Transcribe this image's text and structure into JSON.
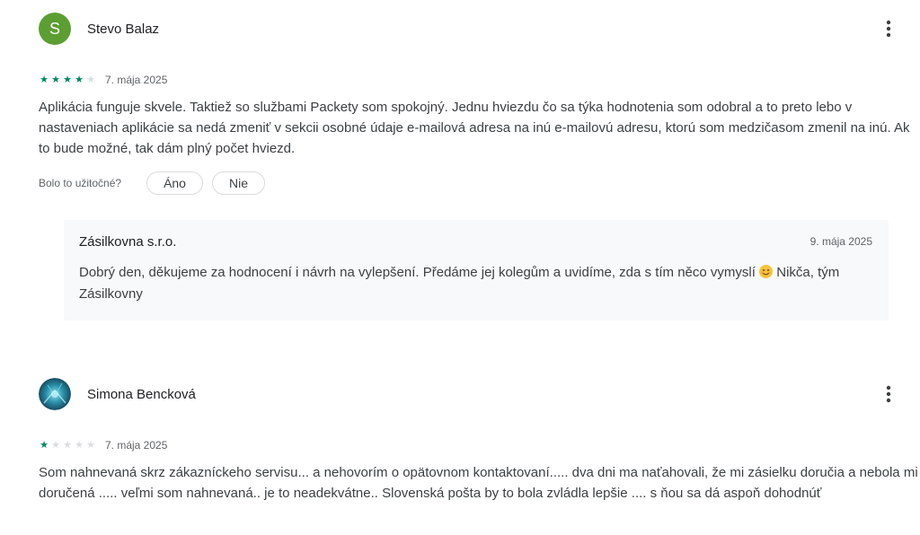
{
  "reviews": [
    {
      "author": "Stevo Balaz",
      "avatar_letter": "S",
      "avatar_color": "#5c9e31",
      "rating": 4,
      "max_rating": 5,
      "date": "7. mája 2025",
      "text": "Aplikácia funguje skvele. Taktiež so službami Packety som spokojný. Jednu hviezdu čo sa týka hodnotenia som odobral a to preto lebo v nastaveniach aplikácie sa nedá zmeniť v sekcii osobné údaje e-mailová adresa na inú e-mailovú adresu, ktorú som medzičasom zmenil na inú. Ak to bude možné, tak dám plný počet hviezd.",
      "helpful_label": "Bolo to užitočné?",
      "yes_label": "Áno",
      "no_label": "Nie",
      "developer_reply": {
        "name": "Zásilkovna s.r.o.",
        "date": "9. mája 2025",
        "text_before_emoji": "Dobrý den, děkujeme za hodnocení i návrh na vylepšení. Předáme jej kolegům a uvidíme, zda s tím něco vymyslí",
        "emoji": "smiling-face-emoji",
        "text_after_emoji": "Nikča, tým Zásilkovny"
      }
    },
    {
      "author": "Simona Bencková",
      "avatar": "photo-avatar",
      "rating": 1,
      "max_rating": 5,
      "date": "7. mája 2025",
      "text": "Som nahnevaná skrz zákazníckeho servisu... a nehovorím o opätovnom kontaktovaní..... dva dni ma naťahovali, že mi zásielku doručia a nebola mi doručená ..... veľmi som nahnevaná.. je to neadekvátne.. Slovenská pošta by to bola zvládla lepšie .... s ňou sa dá aspoň dohodnúť"
    }
  ],
  "icons": {
    "more": "more-vert-icon",
    "star": "star-icon"
  },
  "colors": {
    "star_on": "#01875f",
    "star_off": "#dadce0"
  }
}
